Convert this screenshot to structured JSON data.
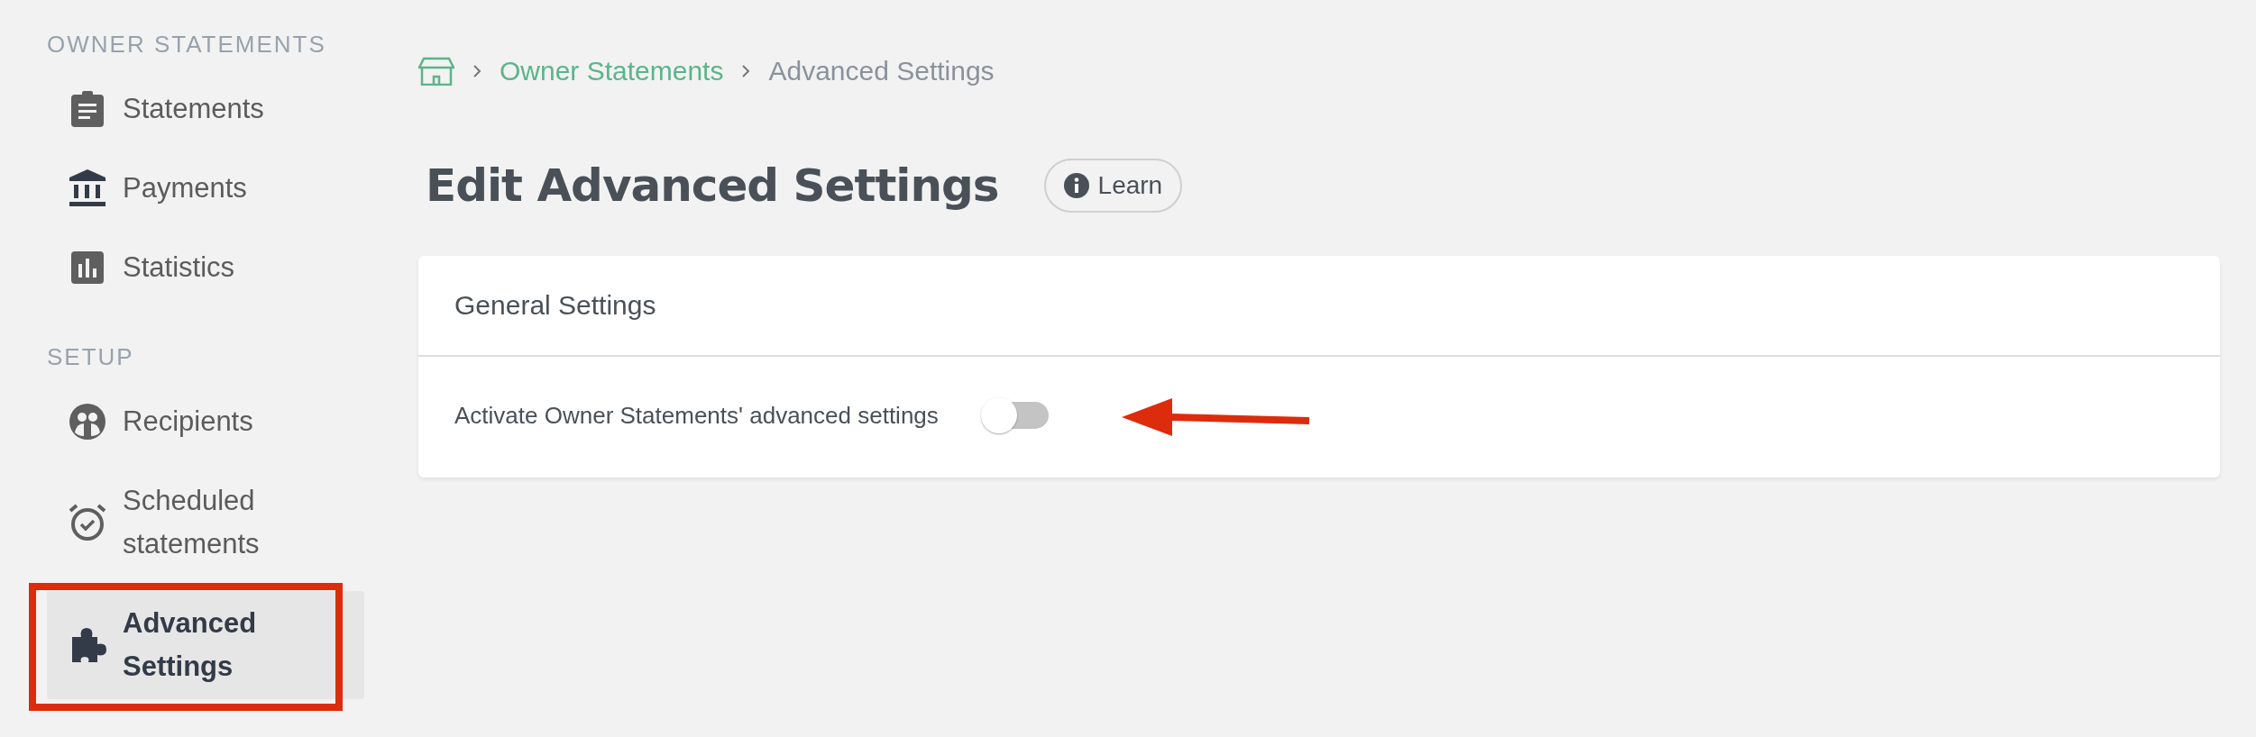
{
  "sidebar": {
    "sections": [
      {
        "heading": "OWNER STATEMENTS",
        "items": [
          {
            "label": "Statements",
            "selected": false
          },
          {
            "label": "Payments",
            "selected": false
          },
          {
            "label": "Statistics",
            "selected": false
          }
        ]
      },
      {
        "heading": "SETUP",
        "items": [
          {
            "label": "Recipients",
            "selected": false
          },
          {
            "label": "Scheduled statements",
            "selected": false
          },
          {
            "label": "Advanced Settings",
            "selected": true
          }
        ]
      }
    ]
  },
  "breadcrumb": {
    "items": [
      {
        "label": "Owner Statements",
        "kind": "link"
      },
      {
        "label": "Advanced Settings",
        "kind": "current"
      }
    ]
  },
  "page": {
    "title": "Edit Advanced Settings",
    "learn_button": "Learn"
  },
  "card": {
    "title": "General Settings",
    "settings": [
      {
        "label": "Activate Owner Statements' advanced settings",
        "on": false
      }
    ]
  },
  "annotations": {
    "highlight_box": {
      "color": "#dd2c0c"
    },
    "arrow": {
      "color": "#dd2c0c"
    }
  }
}
